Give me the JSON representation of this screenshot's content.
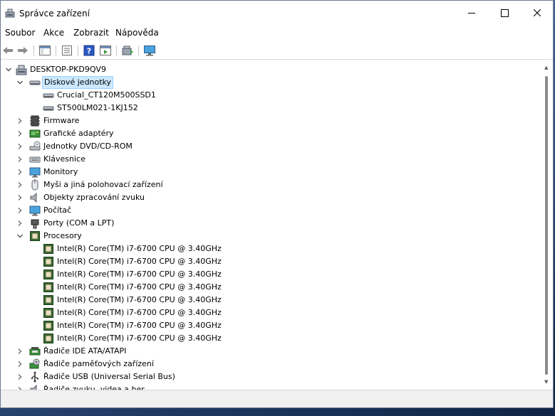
{
  "window": {
    "title": "Správce zařízení"
  },
  "menu": [
    "Soubor",
    "Akce",
    "Zobrazit",
    "Nápověda"
  ],
  "tree": [
    {
      "label": "DESKTOP-PKD9QV9",
      "level": 0,
      "expander": "expanded",
      "icon": "computer-icon"
    },
    {
      "label": "Diskové jednotky",
      "level": 1,
      "expander": "expanded",
      "icon": "disk-drive-icon",
      "selected": true
    },
    {
      "label": "Crucial_CT120M500SSD1",
      "level": 2,
      "expander": "none",
      "icon": "disk-drive-icon"
    },
    {
      "label": "ST500LM021-1KJ152",
      "level": 2,
      "expander": "none",
      "icon": "disk-drive-icon"
    },
    {
      "label": "Firmware",
      "level": 1,
      "expander": "collapsed",
      "icon": "firmware-icon"
    },
    {
      "label": "Grafické adaptéry",
      "level": 1,
      "expander": "collapsed",
      "icon": "display-adapter-icon"
    },
    {
      "label": "Jednotky DVD/CD-ROM",
      "level": 1,
      "expander": "collapsed",
      "icon": "dvd-drive-icon"
    },
    {
      "label": "Klávesnice",
      "level": 1,
      "expander": "collapsed",
      "icon": "keyboard-icon"
    },
    {
      "label": "Monitory",
      "level": 1,
      "expander": "collapsed",
      "icon": "monitor-icon"
    },
    {
      "label": "Myši a jiná polohovací zařízení",
      "level": 1,
      "expander": "collapsed",
      "icon": "mouse-icon"
    },
    {
      "label": "Objekty zpracování zvuku",
      "level": 1,
      "expander": "collapsed",
      "icon": "speaker-icon"
    },
    {
      "label": "Počítač",
      "level": 1,
      "expander": "collapsed",
      "icon": "monitor-icon"
    },
    {
      "label": "Porty (COM a LPT)",
      "level": 1,
      "expander": "collapsed",
      "icon": "port-icon"
    },
    {
      "label": "Procesory",
      "level": 1,
      "expander": "expanded",
      "icon": "processor-icon"
    },
    {
      "label": "Intel(R) Core(TM) i7-6700 CPU @ 3.40GHz",
      "level": 2,
      "expander": "none",
      "icon": "processor-icon"
    },
    {
      "label": "Intel(R) Core(TM) i7-6700 CPU @ 3.40GHz",
      "level": 2,
      "expander": "none",
      "icon": "processor-icon"
    },
    {
      "label": "Intel(R) Core(TM) i7-6700 CPU @ 3.40GHz",
      "level": 2,
      "expander": "none",
      "icon": "processor-icon"
    },
    {
      "label": "Intel(R) Core(TM) i7-6700 CPU @ 3.40GHz",
      "level": 2,
      "expander": "none",
      "icon": "processor-icon"
    },
    {
      "label": "Intel(R) Core(TM) i7-6700 CPU @ 3.40GHz",
      "level": 2,
      "expander": "none",
      "icon": "processor-icon"
    },
    {
      "label": "Intel(R) Core(TM) i7-6700 CPU @ 3.40GHz",
      "level": 2,
      "expander": "none",
      "icon": "processor-icon"
    },
    {
      "label": "Intel(R) Core(TM) i7-6700 CPU @ 3.40GHz",
      "level": 2,
      "expander": "none",
      "icon": "processor-icon"
    },
    {
      "label": "Intel(R) Core(TM) i7-6700 CPU @ 3.40GHz",
      "level": 2,
      "expander": "none",
      "icon": "processor-icon"
    },
    {
      "label": "Řadiče IDE ATA/ATAPI",
      "level": 1,
      "expander": "collapsed",
      "icon": "ide-controller-icon"
    },
    {
      "label": "Řadiče paměťových zařízení",
      "level": 1,
      "expander": "collapsed",
      "icon": "storage-controller-icon"
    },
    {
      "label": "Řadiče USB (Universal Serial Bus)",
      "level": 1,
      "expander": "collapsed",
      "icon": "usb-icon"
    },
    {
      "label": "Řadiče zvuku, videa a her",
      "level": 1,
      "expander": "collapsed",
      "icon": "speaker-icon"
    }
  ],
  "colors": {
    "selection_bg": "#cce8ff",
    "selection_border": "#99d1ff"
  }
}
